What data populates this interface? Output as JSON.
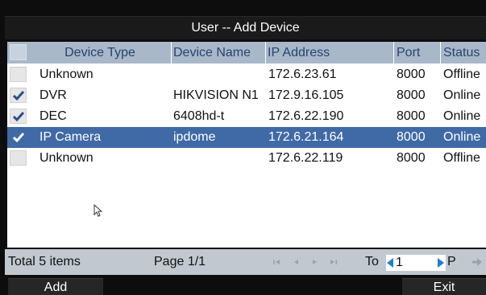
{
  "window": {
    "title": "User -- Add Device"
  },
  "table": {
    "columns": [
      "Device Type",
      "Device Name",
      "IP Address",
      "Port",
      "Status"
    ],
    "rows": [
      {
        "checked": false,
        "selected": false,
        "type": "Unknown",
        "name": "",
        "ip": "172.6.23.61",
        "port": "8000",
        "status": "Offline"
      },
      {
        "checked": true,
        "selected": false,
        "type": "DVR",
        "name": "HIKVISION N1",
        "ip": "172.9.16.105",
        "port": "8000",
        "status": "Online"
      },
      {
        "checked": true,
        "selected": false,
        "type": "DEC",
        "name": "6408hd-t",
        "ip": "172.6.22.190",
        "port": "8000",
        "status": "Online"
      },
      {
        "checked": true,
        "selected": true,
        "type": "IP Camera",
        "name": "ipdome",
        "ip": "172.6.21.164",
        "port": "8000",
        "status": "Online"
      },
      {
        "checked": false,
        "selected": false,
        "type": "Unknown",
        "name": "",
        "ip": "172.6.22.119",
        "port": "8000",
        "status": "Offline"
      }
    ]
  },
  "footer": {
    "total": "Total 5 items",
    "page": "Page 1/1",
    "to_label": "To",
    "page_input": "1",
    "p_label": "P"
  },
  "buttons": {
    "add": "Add",
    "exit": "Exit"
  },
  "icons": {
    "nav_first": "first-page-icon",
    "nav_prev": "prev-page-icon",
    "nav_next": "next-page-icon",
    "nav_last": "last-page-icon",
    "go": "go-arrow-icon",
    "cursor": "mouse-pointer-icon"
  },
  "colors": {
    "header_bg": "#a9b8c9",
    "header_text": "#25446f",
    "selected_row": "#3f6aa6",
    "check": "#2a4f8a",
    "spin_arrow": "#1e7fd6"
  }
}
